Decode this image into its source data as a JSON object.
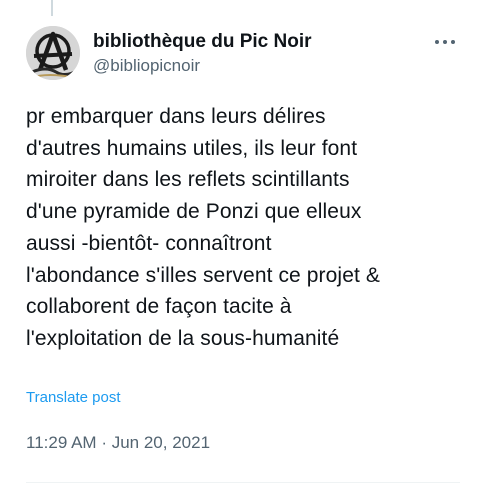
{
  "author": {
    "display_name": "bibliothèque du Pic Noir",
    "handle": "@bibliopicnoir"
  },
  "post": {
    "text": "pr embarquer dans leurs délires\nd'autres humains utiles, ils leur font\nmiroiter dans les reflets scintillants\nd'une pyramide de Ponzi que elleux\naussi -bientôt- connaîtront\nl'abondance s'illes servent ce projet &\ncollaborent de façon tacite à\nl'exploitation de la sous-humanité",
    "translate_label": "Translate post",
    "time": "11:29 AM",
    "separator": "·",
    "date": "Jun 20, 2021"
  },
  "icons": {
    "more": "more-horizontal-icon",
    "avatar": "anarchist-a-logo"
  },
  "colors": {
    "text": "#0f1419",
    "secondary": "#536471",
    "link": "#1d9bf0"
  }
}
